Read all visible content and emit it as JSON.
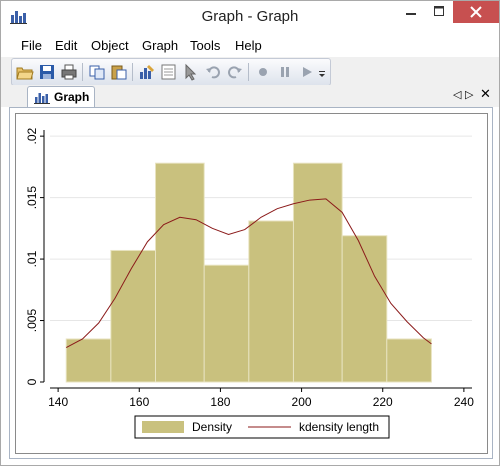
{
  "window": {
    "title": "Graph - Graph"
  },
  "menu": [
    "File",
    "Edit",
    "Object",
    "Graph",
    "Tools",
    "Help"
  ],
  "toolbar": {
    "buttons": [
      "open-icon",
      "save-icon",
      "print-icon",
      "copy-icon",
      "paste-icon",
      "graph-editor-icon",
      "data-editor-icon",
      "pointer-icon",
      "undo-icon",
      "redo-icon",
      "record-icon",
      "pause-icon",
      "play-icon",
      "dropdown-icon"
    ]
  },
  "tab": {
    "label": "Graph"
  },
  "colors": {
    "bar_fill": "#c9c17e",
    "bar_stroke": "#e8e3c0",
    "kde_line": "#8b1a1a",
    "close_red": "#c75050"
  },
  "chart_data": {
    "type": "bar",
    "bins": [
      {
        "x0": 142,
        "x1": 153,
        "density": 0.0035
      },
      {
        "x0": 153,
        "x1": 164,
        "density": 0.0107
      },
      {
        "x0": 164,
        "x1": 176,
        "density": 0.0178
      },
      {
        "x0": 176,
        "x1": 187,
        "density": 0.0095
      },
      {
        "x0": 187,
        "x1": 198,
        "density": 0.0131
      },
      {
        "x0": 198,
        "x1": 210,
        "density": 0.0178
      },
      {
        "x0": 210,
        "x1": 221,
        "density": 0.0119
      },
      {
        "x0": 221,
        "x1": 232,
        "density": 0.0035
      }
    ],
    "kdensity": {
      "x": [
        142,
        146,
        150,
        154,
        158,
        162,
        166,
        170,
        174,
        178,
        182,
        186,
        190,
        194,
        198,
        202,
        206,
        210,
        214,
        218,
        222,
        226,
        230,
        232
      ],
      "y": [
        0.0028,
        0.0035,
        0.0048,
        0.0068,
        0.0092,
        0.0114,
        0.0128,
        0.0134,
        0.0132,
        0.0125,
        0.012,
        0.0124,
        0.0134,
        0.0141,
        0.0145,
        0.0148,
        0.0149,
        0.0138,
        0.0115,
        0.0086,
        0.0064,
        0.0049,
        0.0036,
        0.0031
      ]
    },
    "xlim": [
      138,
      242
    ],
    "ylim": [
      0,
      0.0205
    ],
    "xticks": [
      "140",
      "160",
      "180",
      "200",
      "220",
      "240"
    ],
    "xtick_values": [
      140,
      160,
      180,
      200,
      220,
      240
    ],
    "yticks": [
      "0",
      ".005",
      ".01",
      ".015",
      ".02"
    ],
    "ytick_values": [
      0,
      0.005,
      0.01,
      0.015,
      0.02
    ],
    "grid": "horizontal",
    "legend": {
      "placement": "bottom",
      "entries": [
        "Density",
        "kdensity length"
      ]
    }
  }
}
